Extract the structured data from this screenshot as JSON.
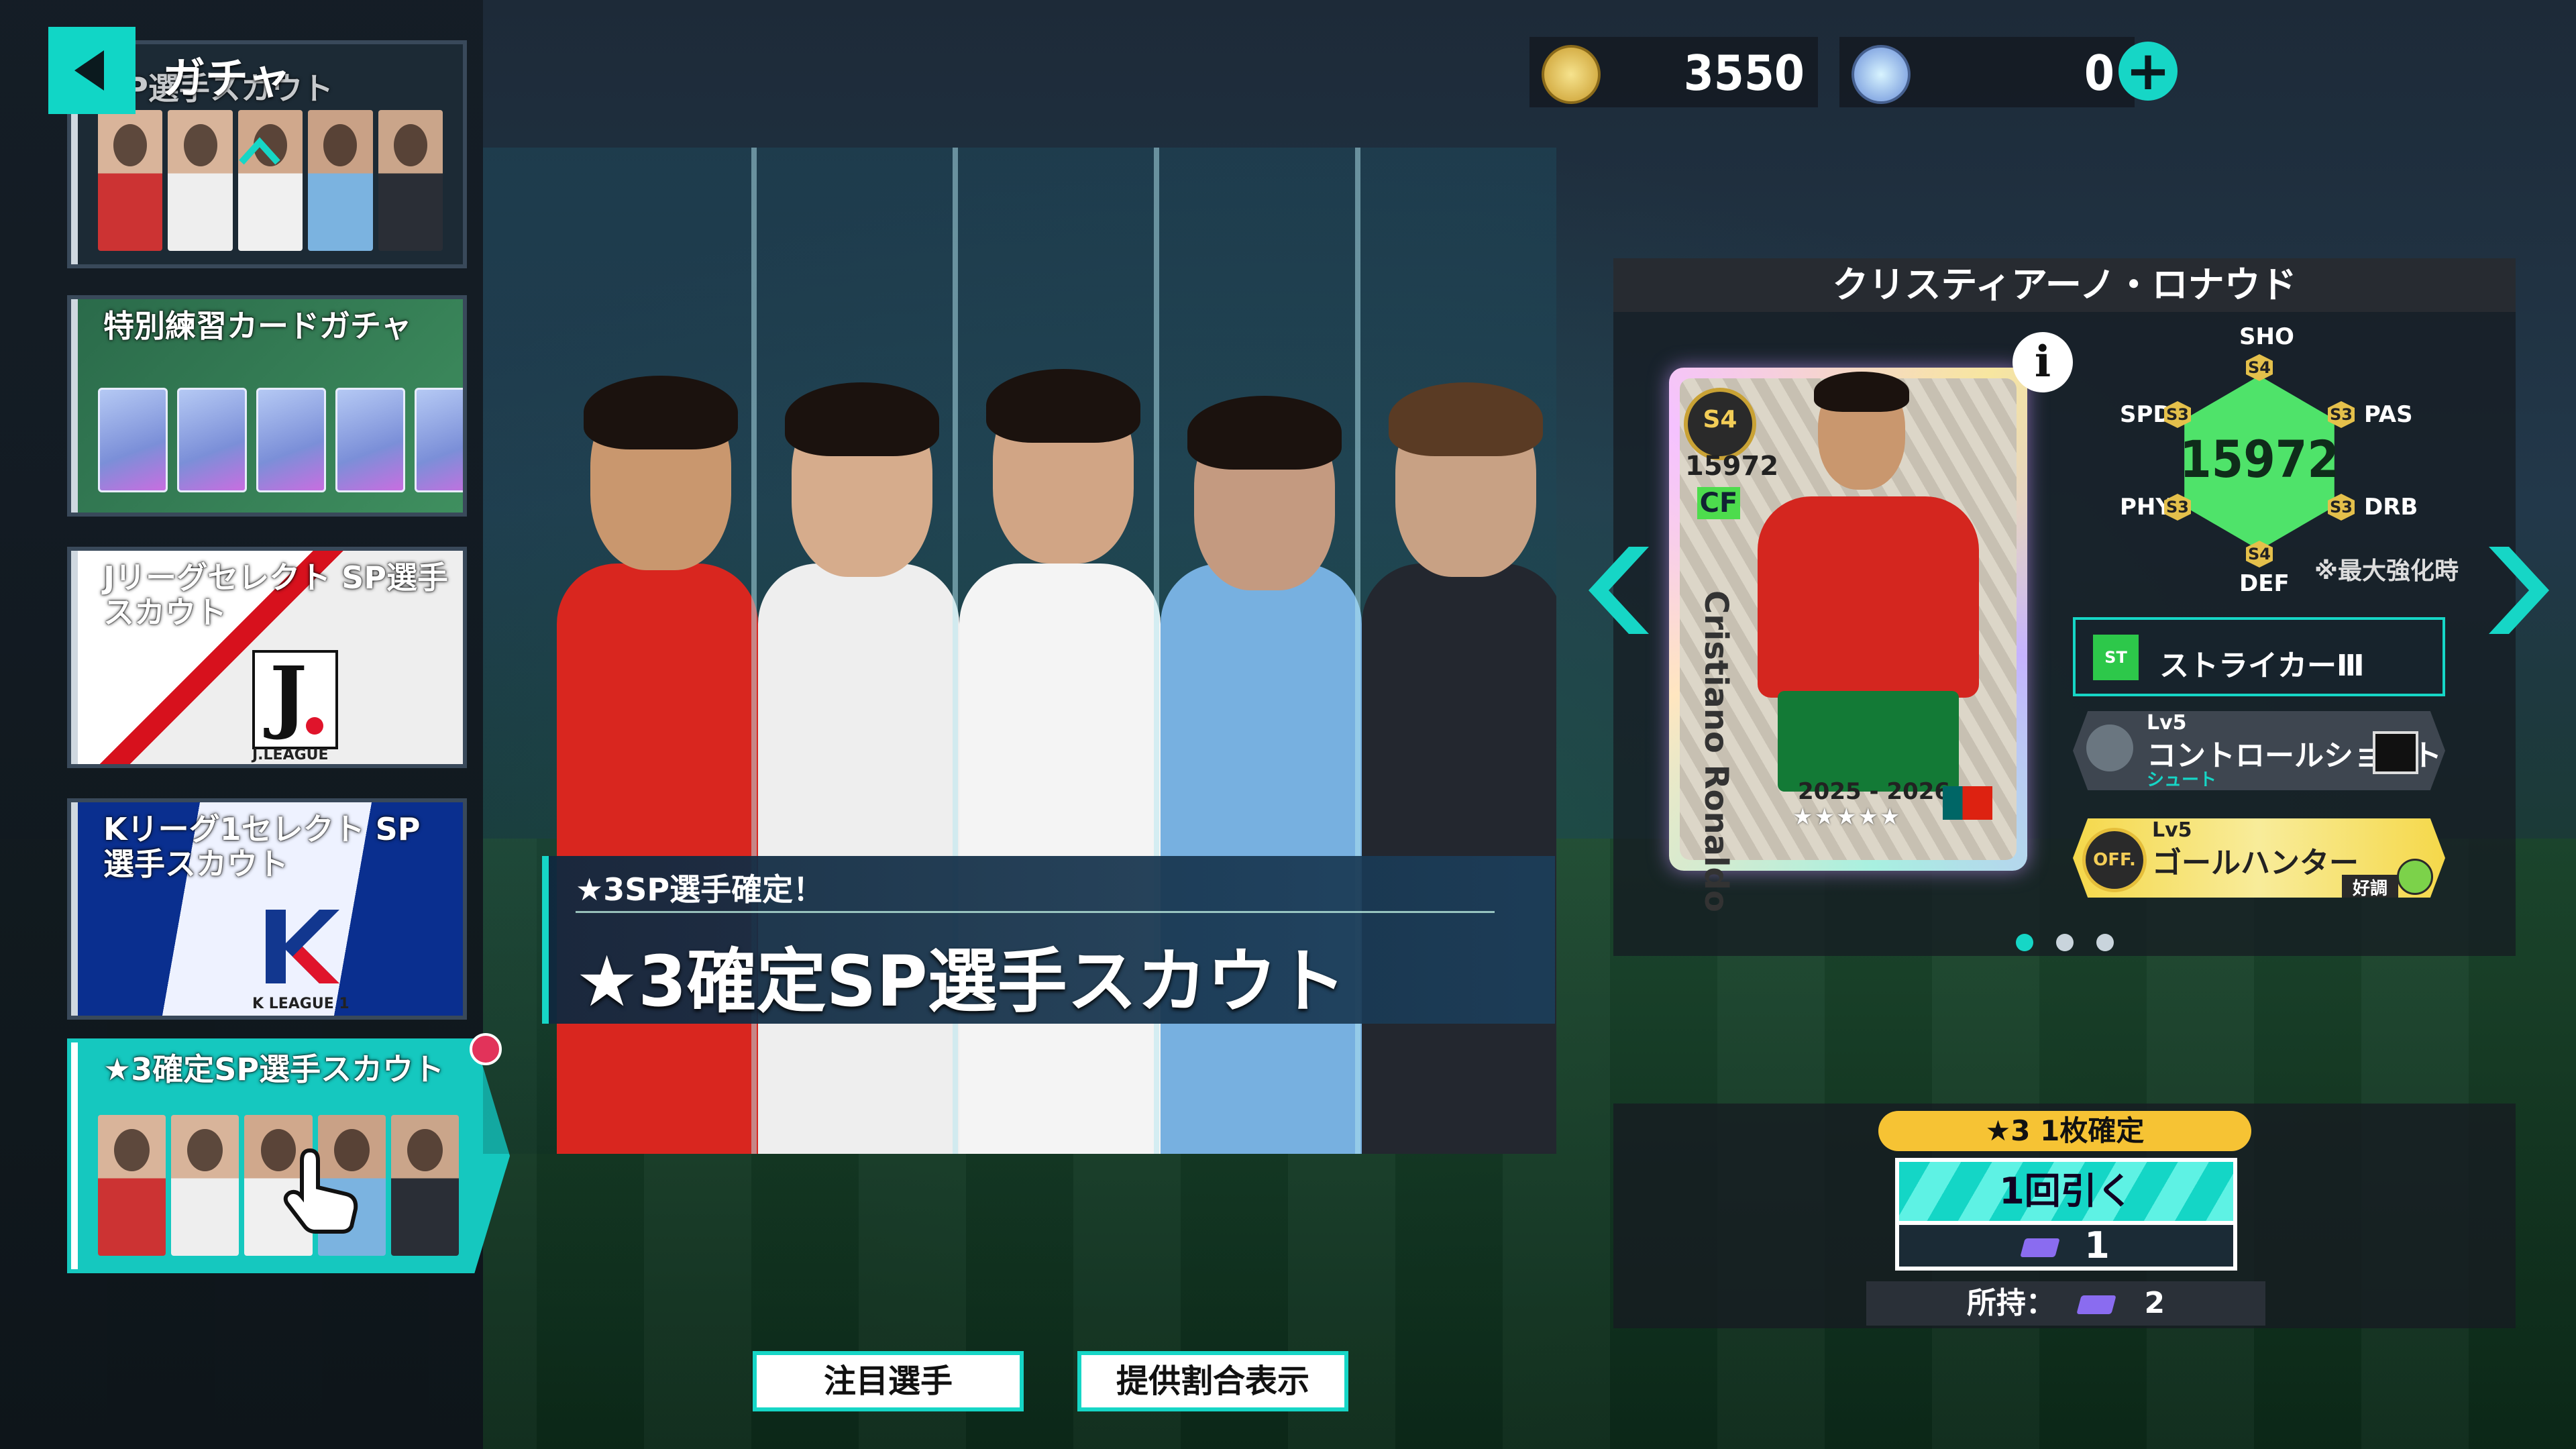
{
  "header": {
    "title": "ガチャ",
    "coins": "3550",
    "gems": "0"
  },
  "sidebar": {
    "items": [
      {
        "label": "SP選手スカウト"
      },
      {
        "label": "特別練習カードガチャ"
      },
      {
        "label": "Jリーグセレクト SP選手スカウト",
        "logo": "J.LEAGUE"
      },
      {
        "label": "Kリーグ1セレクト SP選手スカウト",
        "logo": "K LEAGUE 1"
      },
      {
        "label": "★3確定SP選手スカウト"
      }
    ]
  },
  "banner": {
    "subtitle": "★3SP選手確定！",
    "title": "★3確定SP選手スカウト"
  },
  "player": {
    "name": "クリスティアーノ・ロナウド",
    "card_name": "Cristiano Ronaldo",
    "rank": "S4",
    "overall": "15972",
    "position": "CF",
    "season": "2025 - 2026",
    "stars": "★★★★★",
    "note": "※最大強化時",
    "stats": {
      "sho": "SHO",
      "pas": "PAS",
      "drb": "DRB",
      "def": "DEF",
      "phy": "PHY",
      "spd": "SPD",
      "sho_rank": "S4",
      "pas_rank": "S3",
      "drb_rank": "S3",
      "def_rank": "S4",
      "phy_rank": "S3",
      "spd_rank": "S3"
    },
    "skills": [
      {
        "tag": "ST",
        "label": "ストライカーⅢ"
      },
      {
        "level": "Lv5",
        "label": "コントロールショット",
        "sub": "シュート"
      },
      {
        "level": "Lv5",
        "label": "ゴールハンター",
        "badge": "OFF.",
        "sub": "好調"
      }
    ]
  },
  "pull": {
    "guarantee": "★3 1枚確定",
    "button_label": "1回引く",
    "cost": "1",
    "owned_label": "所持：",
    "owned_count": "2"
  },
  "footer": {
    "featured": "注目選手",
    "rates": "提供割合表示"
  },
  "colors": {
    "accent": "#16d6c6",
    "gold": "#f6c334",
    "stat_green": "#4fe36a"
  }
}
